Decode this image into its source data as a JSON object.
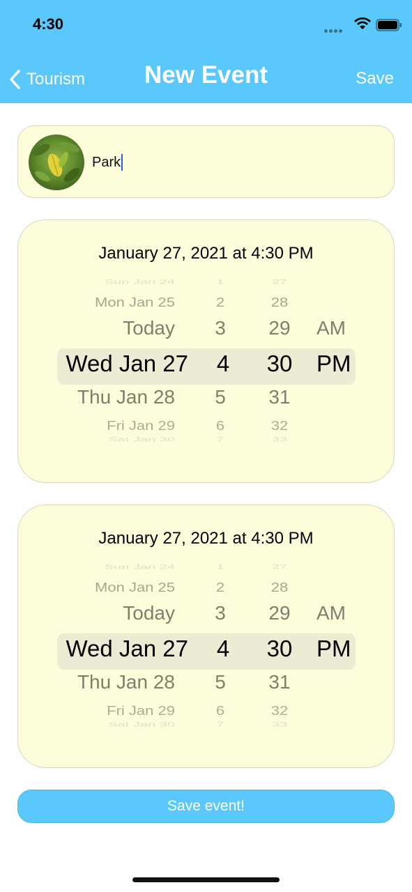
{
  "status_bar": {
    "time": "4:30"
  },
  "nav": {
    "back_label": "Tourism",
    "title": "New Event",
    "save_label": "Save"
  },
  "name_field": {
    "value": "Park"
  },
  "pickers": [
    {
      "date_label": "January 27, 2021 at 4:30 PM",
      "rows": [
        {
          "day": "Sun Jan 24",
          "hour": "1",
          "minute": "27",
          "ampm": ""
        },
        {
          "day": "Mon Jan 25",
          "hour": "2",
          "minute": "28",
          "ampm": ""
        },
        {
          "day": "Today",
          "hour": "3",
          "minute": "29",
          "ampm": "AM"
        },
        {
          "day": "Wed Jan 27",
          "hour": "4",
          "minute": "30",
          "ampm": "PM"
        },
        {
          "day": "Thu Jan 28",
          "hour": "5",
          "minute": "31",
          "ampm": ""
        },
        {
          "day": "Fri Jan 29",
          "hour": "6",
          "minute": "32",
          "ampm": ""
        },
        {
          "day": "Sat Jan 30",
          "hour": "7",
          "minute": "33",
          "ampm": ""
        }
      ]
    },
    {
      "date_label": "January 27, 2021 at 4:30 PM",
      "rows": [
        {
          "day": "Sun Jan 24",
          "hour": "1",
          "minute": "27",
          "ampm": ""
        },
        {
          "day": "Mon Jan 25",
          "hour": "2",
          "minute": "28",
          "ampm": ""
        },
        {
          "day": "Today",
          "hour": "3",
          "minute": "29",
          "ampm": "AM"
        },
        {
          "day": "Wed Jan 27",
          "hour": "4",
          "minute": "30",
          "ampm": "PM"
        },
        {
          "day": "Thu Jan 28",
          "hour": "5",
          "minute": "31",
          "ampm": ""
        },
        {
          "day": "Fri Jan 29",
          "hour": "6",
          "minute": "32",
          "ampm": ""
        },
        {
          "day": "Sat Jan 30",
          "hour": "7",
          "minute": "33",
          "ampm": ""
        }
      ]
    }
  ],
  "save_event_label": "Save event!",
  "colors": {
    "header": "#5ac8fa",
    "card": "#fdfcdb",
    "button": "#5ac8fa"
  }
}
